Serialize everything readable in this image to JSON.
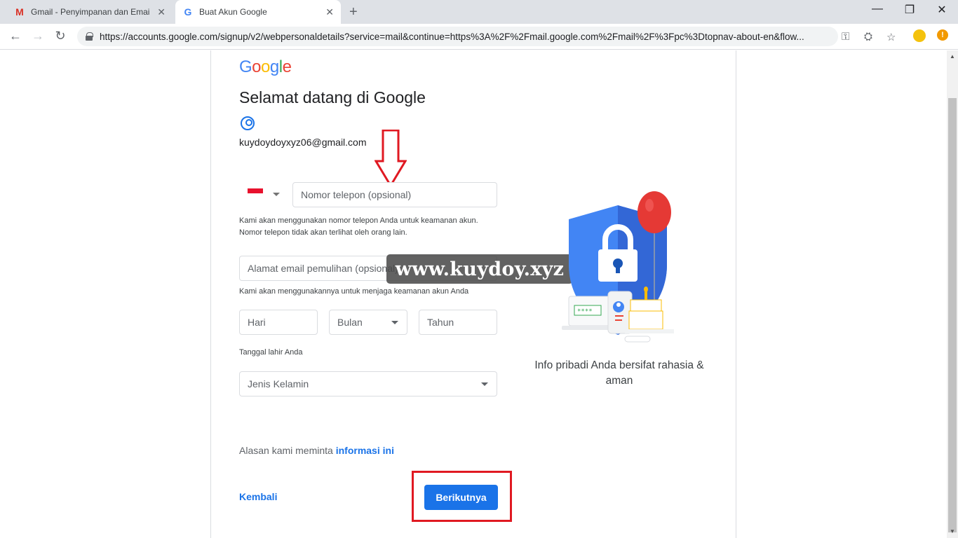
{
  "browser": {
    "tabs": [
      {
        "title": "Gmail - Penyimpanan dan Email G",
        "favicon": "gmail-icon"
      },
      {
        "title": "Buat Akun Google",
        "favicon": "google-g-icon"
      }
    ],
    "url": "https://accounts.google.com/signup/v2/webpersonaldetails?service=mail&continue=https%3A%2F%2Fmail.google.com%2Fmail%2F%3Fpc%3Dtopnav-about-en&flow..."
  },
  "page": {
    "logo": "Google",
    "heading": "Selamat datang di Google",
    "email": "kuydoydoyxyz06@gmail.com",
    "phone": {
      "placeholder": "Nomor telepon (opsional)",
      "help": "Kami akan menggunakan nomor telepon Anda untuk keamanan akun. Nomor telepon tidak akan terlihat oleh orang lain."
    },
    "recovery": {
      "placeholder": "Alamat email pemulihan (opsional)",
      "help": "Kami akan menggunakannya untuk menjaga keamanan akun Anda"
    },
    "birthday": {
      "day": "Hari",
      "month": "Bulan",
      "year": "Tahun",
      "label": "Tanggal lahir Anda"
    },
    "gender": {
      "placeholder": "Jenis Kelamin"
    },
    "reason_text": "Alasan kami meminta",
    "reason_link": "informasi ini",
    "back_label": "Kembali",
    "next_label": "Berikutnya",
    "caption": "Info pribadi Anda bersifat rahasia & aman",
    "watermark": "www.kuydoy.xyz"
  },
  "colors": {
    "accent": "#1a73e8",
    "highlight": "#e01922"
  }
}
